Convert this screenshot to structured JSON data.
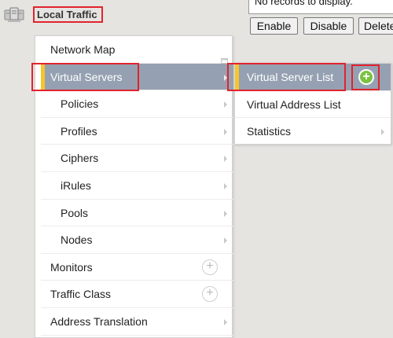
{
  "section": {
    "title": "Local Traffic",
    "icon": "local-traffic-icon"
  },
  "records": {
    "message": "No records to display.",
    "buttons": [
      "Enable",
      "Disable",
      "Delete"
    ]
  },
  "menu": {
    "items": [
      {
        "label": "Network Map",
        "icon": "external-window-icon"
      },
      {
        "label": "Virtual Servers",
        "icon": "chevron-right-icon",
        "active": true
      },
      {
        "label": "Policies",
        "icon": "chevron-right-icon"
      },
      {
        "label": "Profiles",
        "icon": "chevron-right-icon"
      },
      {
        "label": "Ciphers",
        "icon": "chevron-right-icon"
      },
      {
        "label": "iRules",
        "icon": "chevron-right-icon"
      },
      {
        "label": "Pools",
        "icon": "chevron-right-icon"
      },
      {
        "label": "Nodes",
        "icon": "chevron-right-icon"
      },
      {
        "label": "Monitors",
        "icon": "plus-circle-icon"
      },
      {
        "label": "Traffic Class",
        "icon": "plus-circle-icon"
      },
      {
        "label": "Address Translation",
        "icon": "chevron-right-icon"
      }
    ]
  },
  "submenu": {
    "items": [
      {
        "label": "Virtual Server List",
        "icon": "green-plus-icon",
        "active": true
      },
      {
        "label": "Virtual Address List"
      },
      {
        "label": "Statistics",
        "icon": "chevron-right-icon"
      }
    ]
  },
  "colors": {
    "active_bg": "#95a1b2",
    "highlight_border": "#e2232c",
    "indicator": "#f7c52b",
    "create_green": "#7cc242"
  }
}
